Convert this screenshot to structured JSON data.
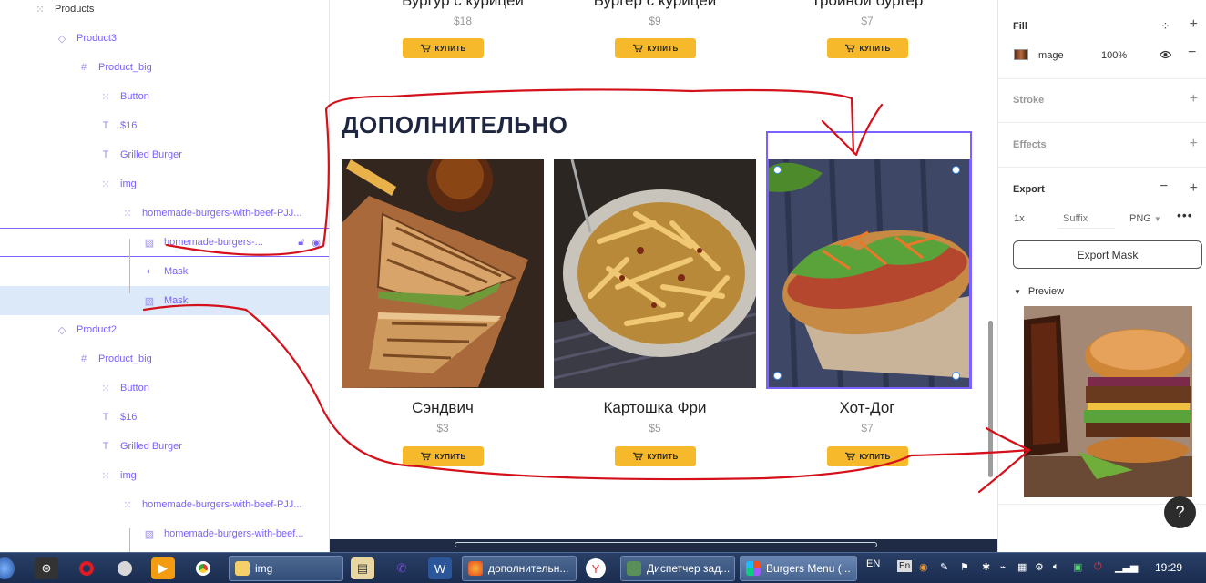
{
  "layers": {
    "items": [
      {
        "label": "Products",
        "kind": "frame-icon"
      },
      {
        "label": "Product3",
        "kind": "component-icon"
      },
      {
        "label": "Product_big",
        "kind": "frame-icon"
      },
      {
        "label": "Button",
        "kind": "frame-icon"
      },
      {
        "label": "$16",
        "kind": "text-icon"
      },
      {
        "label": "Grilled Burger",
        "kind": "text-icon"
      },
      {
        "label": "img",
        "kind": "frame-icon"
      },
      {
        "label": "homemade-burgers-with-beef-PJJ...",
        "kind": "frame-icon"
      },
      {
        "label": "homemade-burgers-...",
        "kind": "image-icon"
      },
      {
        "label": "Mask",
        "kind": "mask-icon"
      },
      {
        "label": "Mask",
        "kind": "image-icon"
      },
      {
        "label": "Product2",
        "kind": "component-icon"
      },
      {
        "label": "Product_big",
        "kind": "frame-icon"
      },
      {
        "label": "Button",
        "kind": "frame-icon"
      },
      {
        "label": "$16",
        "kind": "text-icon"
      },
      {
        "label": "Grilled Burger",
        "kind": "text-icon"
      },
      {
        "label": "img",
        "kind": "frame-icon"
      },
      {
        "label": "homemade-burgers-with-beef-PJJ...",
        "kind": "frame-icon"
      },
      {
        "label": "homemade-burgers-with-beef...",
        "kind": "image-icon"
      }
    ]
  },
  "canvas": {
    "top_products": [
      {
        "title": "Бургур с курицей",
        "price": "$18",
        "buy": "КУПИТЬ"
      },
      {
        "title": "Бургер с курицей",
        "price": "$9",
        "buy": "КУПИТЬ"
      },
      {
        "title": "Тройной бургер",
        "price": "$7",
        "buy": "КУПИТЬ"
      }
    ],
    "section_title": "ДОПОЛНИТЕЛЬНО",
    "products": [
      {
        "name": "Сэндвич",
        "price": "$3",
        "buy": "КУПИТЬ",
        "image": "sandwich-photo"
      },
      {
        "name": "Картошка Фри",
        "price": "$5",
        "buy": "КУПИТЬ",
        "image": "fries-photo"
      },
      {
        "name": "Хот-Дог",
        "price": "$7",
        "buy": "КУПИТЬ",
        "image": "hotdog-photo"
      }
    ],
    "accent_color": "#f6b92b",
    "selection_color": "#7b61ff"
  },
  "properties": {
    "fill": {
      "title": "Fill",
      "type": "Image",
      "opacity": "100%"
    },
    "stroke": {
      "title": "Stroke"
    },
    "effects": {
      "title": "Effects"
    },
    "export": {
      "title": "Export",
      "scale": "1x",
      "suffix_placeholder": "Suffix",
      "format": "PNG",
      "button": "Export Mask"
    },
    "preview": {
      "label": "Preview",
      "image": "burger-with-cola-photo"
    },
    "help": "?"
  },
  "taskbar": {
    "tasks": [
      {
        "label": "img"
      },
      {
        "label": "дополнительн..."
      },
      {
        "label": "Диспетчер зад..."
      },
      {
        "label": "Burgers Menu (..."
      }
    ],
    "lang": "EN",
    "lang_btn": "En",
    "clock": "19:29"
  }
}
